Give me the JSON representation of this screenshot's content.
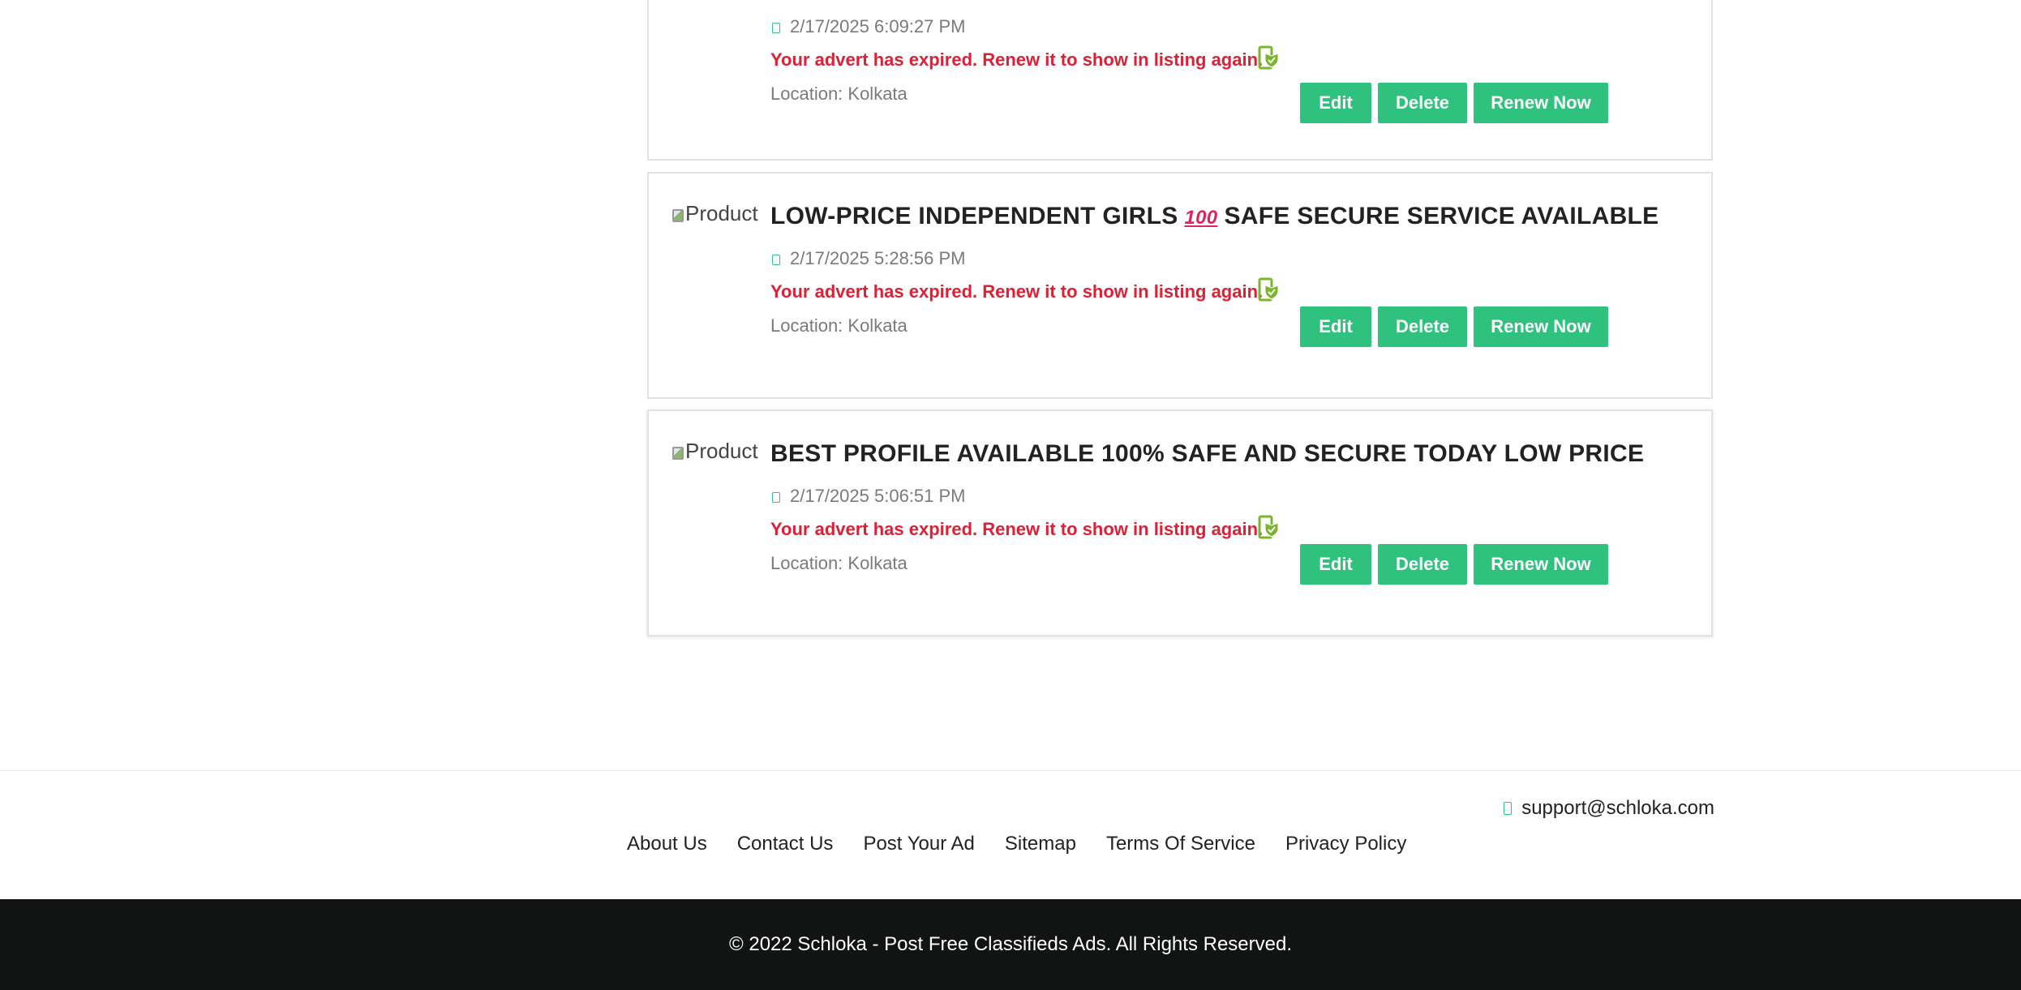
{
  "listings": [
    {
      "title": "",
      "thumb_alt": "Product",
      "date": "2/17/2025 6:09:27 PM",
      "expired_message": "Your advert has expired. Renew it to show in listing again.",
      "location": "Location: Kolkata",
      "actions": {
        "edit": "Edit",
        "delete": "Delete",
        "renew": "Renew Now"
      }
    },
    {
      "title_part1": "LOW-PRICE INDEPENDENT GIRLS",
      "title_emoji": "100",
      "title_part2": "SAFE SECURE SERVICE AVAILABLE",
      "thumb_alt": "Product",
      "date": "2/17/2025 5:28:56 PM",
      "expired_message": "Your advert has expired. Renew it to show in listing again.",
      "location": "Location: Kolkata",
      "actions": {
        "edit": "Edit",
        "delete": "Delete",
        "renew": "Renew Now"
      }
    },
    {
      "title": "BEST PROFILE AVAILABLE 100% SAFE AND SECURE TODAY LOW PRICE",
      "thumb_alt": "Product",
      "date": "2/17/2025 5:06:51 PM",
      "expired_message": "Your advert has expired. Renew it to show in listing again.",
      "location": "Location: Kolkata",
      "actions": {
        "edit": "Edit",
        "delete": "Delete",
        "renew": "Renew Now"
      }
    }
  ],
  "footer": {
    "support_email": "support@schloka.com",
    "links": [
      "About Us",
      "Contact Us",
      "Post Your Ad",
      "Sitemap",
      "Terms Of Service",
      "Privacy Policy"
    ],
    "copyright": "© 2022 Schloka - Post Free Classifieds Ads. All Rights Reserved."
  },
  "colors": {
    "accent": "#2ec27e",
    "expired": "#dc2137",
    "footer_bg": "#121313"
  },
  "icons": [
    "calendar-icon",
    "verified-phone-icon",
    "mail-icon",
    "broken-image-icon"
  ]
}
